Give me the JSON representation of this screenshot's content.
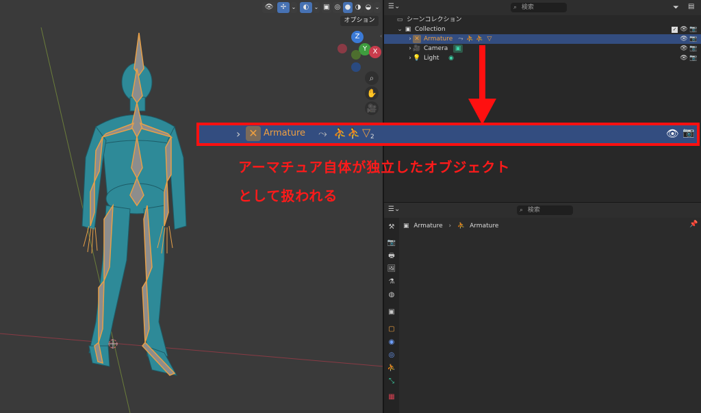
{
  "viewport": {
    "options_label": "オプション",
    "gizmo": {
      "z": "Z",
      "y": "Y",
      "x": "X"
    }
  },
  "outliner": {
    "search_placeholder": "検索",
    "scene_collection": "シーンコレクション",
    "items": [
      {
        "label": "Collection"
      },
      {
        "label": "Armature",
        "selected": true
      },
      {
        "label": "Camera"
      },
      {
        "label": "Light"
      }
    ]
  },
  "properties": {
    "search_placeholder": "検索",
    "breadcrumb": [
      "Armature",
      "Armature"
    ]
  },
  "annotation": {
    "row_label": "Armature",
    "row_subscript": "2",
    "line1": "アーマチュア自体が独立したオブジェクト",
    "line2": "として扱われる"
  },
  "colors": {
    "annotation_red": "#ff1010",
    "selection_blue": "#334d80",
    "armature_orange": "#f0a040",
    "bone_green": "#3dd6a8",
    "mesh_teal": "#2e8a98"
  }
}
